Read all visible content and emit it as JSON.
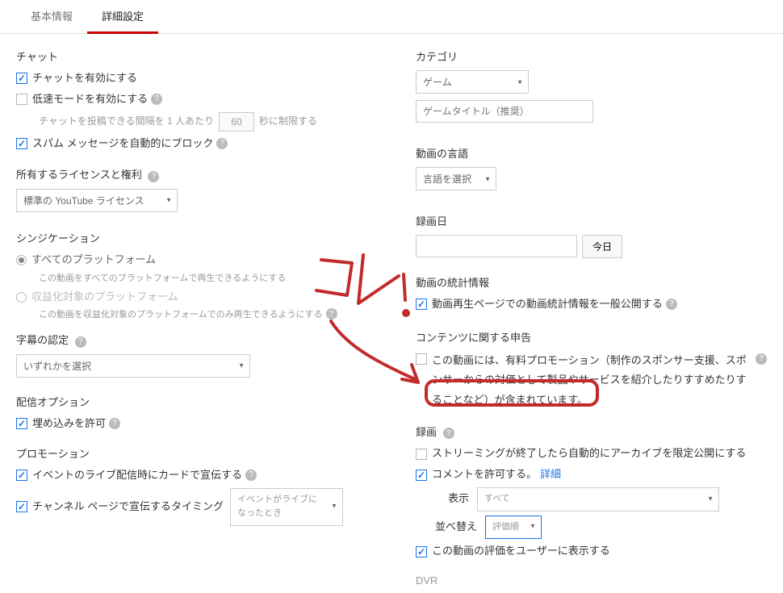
{
  "tabs": {
    "basic": "基本情報",
    "advanced": "詳細設定"
  },
  "left": {
    "chat": {
      "title": "チャット",
      "enable": "チャットを有効にする",
      "slow": "低速モードを有効にする",
      "slowHelp1": "チャットを投稿できる間隔を 1 人あたり",
      "slowHelp2": " 秒に制限する",
      "slowSeconds": "60",
      "spam": "スパム メッセージを自動的にブロック"
    },
    "license": {
      "title": "所有するライセンスと権利",
      "value": "標準の YouTube ライセンス"
    },
    "syndication": {
      "title": "シンジケーション",
      "all": "すべてのプラットフォーム",
      "allSub": "この動画をすべてのプラットフォームで再生できるようにする",
      "mon": "収益化対象のプラットフォーム",
      "monSub": "この動画を収益化対象のプラットフォームでのみ再生できるようにする"
    },
    "subtitle": {
      "title": "字幕の認定",
      "value": "いずれかを選択"
    },
    "delivery": {
      "title": "配信オプション",
      "embed": "埋め込みを許可"
    },
    "promo": {
      "title": "プロモーション",
      "card": "イベントのライブ配信時にカードで宣伝する",
      "channel": "チャンネル ページで宣伝するタイミング",
      "channelVal": "イベントがライブになったとき"
    }
  },
  "right": {
    "category": {
      "title": "カテゴリ",
      "value": "ゲーム",
      "placeholder": "ゲームタイトル（推奨）"
    },
    "lang": {
      "title": "動画の言語",
      "value": "言語を選択"
    },
    "recDate": {
      "title": "録画日",
      "today": "今日"
    },
    "stats": {
      "title": "動画の統計情報",
      "public": "動画再生ページでの動画統計情報を一般公開する"
    },
    "content": {
      "title": "コンテンツに関する申告",
      "line": "この動画には、有料プロモーション（制作のスポンサー支援、スポンサーからの対価として製品やサービスを紹介したりすすめたりすることなど）が含まれています。"
    },
    "rec": {
      "title": "録画",
      "archive": "ストリーミングが終了したら自動的にアーカイブを限定公開にする",
      "comments": "コメントを許可する。",
      "detail": "詳細",
      "dispLabel": "表示",
      "dispVal": "すべて",
      "sortLabel": "並べ替え",
      "sortVal": "評価順",
      "rating": "この動画の評価をユーザーに表示する"
    },
    "dvr": "DVR"
  }
}
